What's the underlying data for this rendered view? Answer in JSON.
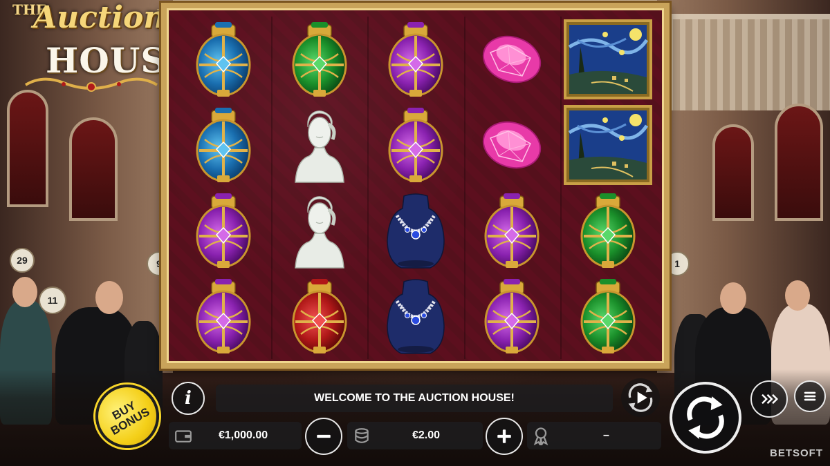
{
  "game": {
    "logo_the": "THE",
    "logo_auction": "Auction",
    "logo_house": "HOUSE",
    "logo_tm": "™",
    "provider": "BETSOFT"
  },
  "reels": {
    "columns": [
      [
        "blue-egg",
        "blue-egg",
        "purple-egg",
        "purple-egg"
      ],
      [
        "green-egg",
        "marble-bust",
        "marble-bust",
        "red-egg"
      ],
      [
        "purple-egg",
        "purple-egg",
        "sapphire-necklace",
        "sapphire-necklace"
      ],
      [
        "pink-gem",
        "pink-gem",
        "purple-egg",
        "purple-egg"
      ],
      [
        "starry-night-painting",
        "starry-night-painting",
        "green-egg",
        "green-egg"
      ]
    ]
  },
  "controls": {
    "buy_bonus_label": "BUY BONUS",
    "info_label": "i",
    "message": "WELCOME TO THE AUCTION HOUSE!",
    "balance": "€1,000.00",
    "bet": "€2.00",
    "last_win": "–"
  },
  "crowd": {
    "paddle_numbers": [
      "29",
      "11",
      "9",
      "1"
    ]
  },
  "colors": {
    "frame_gold": "#c9a35a",
    "reel_background": "#5c0f1e",
    "buy_bonus_yellow": "#f4cf18"
  }
}
